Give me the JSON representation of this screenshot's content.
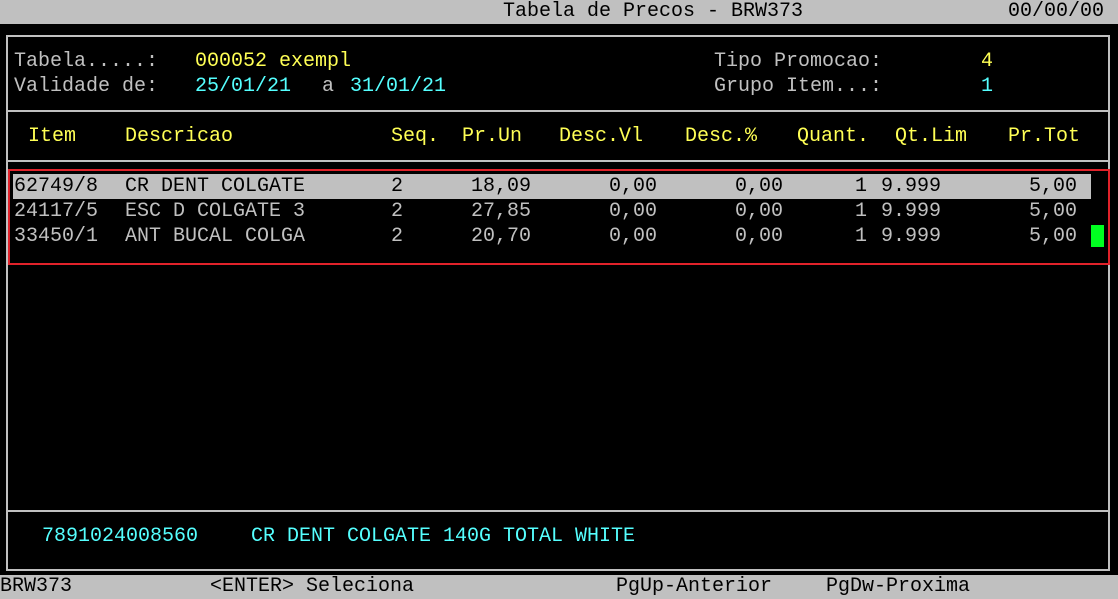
{
  "titlebar": {
    "title": "Tabela de Precos - BRW373",
    "date": "00/00/00"
  },
  "header": {
    "tabela_label": "Tabela.....:",
    "tabela_value": "000052 exempl",
    "validade_label": "Validade de:",
    "validade_from": "25/01/21",
    "validade_sep": "a",
    "validade_to": "31/01/21",
    "tipo_label": "Tipo Promocao:",
    "tipo_value": "4",
    "grupo_label": "Grupo Item...:",
    "grupo_value": "1"
  },
  "columns": {
    "item": "Item",
    "descricao": "Descricao",
    "seq": "Seq.",
    "pr_un": "Pr.Un",
    "desc_vl": "Desc.Vl",
    "desc_pct": "Desc.%",
    "quant": "Quant.",
    "qt_lim": "Qt.Lim",
    "pr_tot": "Pr.Tot"
  },
  "rows": [
    {
      "item": "62749/8",
      "descricao": "CR DENT COLGATE",
      "seq": "2",
      "pr_un": "18,09",
      "desc_vl": "0,00",
      "desc_pct": "0,00",
      "quant": "1",
      "qt_lim": "9.999",
      "pr_tot": "5,00"
    },
    {
      "item": "24117/5",
      "descricao": "ESC D COLGATE 3",
      "seq": "2",
      "pr_un": "27,85",
      "desc_vl": "0,00",
      "desc_pct": "0,00",
      "quant": "1",
      "qt_lim": "9.999",
      "pr_tot": "5,00"
    },
    {
      "item": "33450/1",
      "descricao": "ANT BUCAL COLGA",
      "seq": "2",
      "pr_un": "20,70",
      "desc_vl": "0,00",
      "desc_pct": "0,00",
      "quant": "1",
      "qt_lim": "9.999",
      "pr_tot": "5,00"
    }
  ],
  "footer": {
    "barcode": "7891024008560",
    "full_description": "CR DENT COLGATE 140G TOTAL WHITE"
  },
  "statusbar": {
    "program": "BRW373",
    "enter": "<ENTER> Seleciona",
    "pgup": "PgUp-Anterior",
    "pgdw": "PgDw-Proxima"
  },
  "colors": {
    "background": "#000000",
    "label_gray": "#c0c0c0",
    "value_yellow": "#ffff55",
    "value_cyan": "#55ffff",
    "highlight_border": "#e0222a",
    "cursor_green": "#00ff20"
  }
}
